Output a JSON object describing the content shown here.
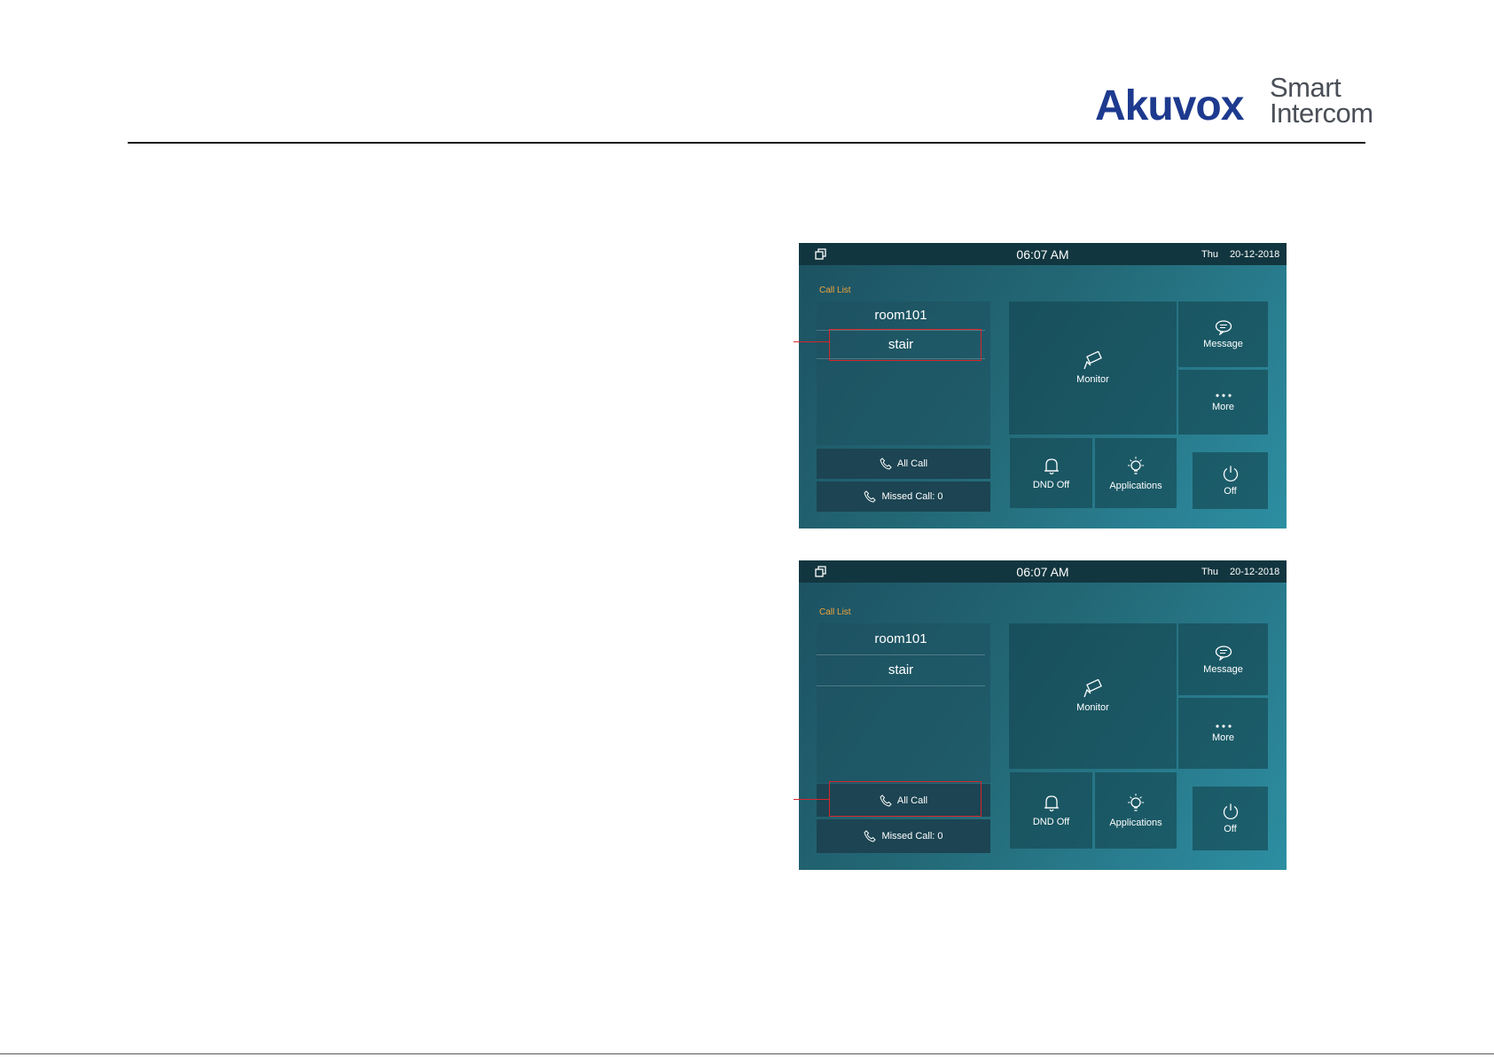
{
  "brand": {
    "logo_name": "Akuvox",
    "logo_tagline_line1": "Smart",
    "logo_tagline_line2": "Intercom",
    "accent_color": "#1d3a8f"
  },
  "screens": [
    {
      "status": {
        "time": "06:07 AM",
        "day": "Thu",
        "date": "20-12-2018"
      },
      "call_list_title": "Call List",
      "call_list": [
        "room101",
        "stair"
      ],
      "highlighted_item": "stair",
      "all_call_label": "All Call",
      "missed_call_label": "Missed Call: 0",
      "tiles": {
        "monitor": "Monitor",
        "message": "Message",
        "more": "More",
        "dnd": "DND Off",
        "applications": "Applications",
        "off": "Off"
      }
    },
    {
      "status": {
        "time": "06:07 AM",
        "day": "Thu",
        "date": "20-12-2018"
      },
      "call_list_title": "Call List",
      "call_list": [
        "room101",
        "stair"
      ],
      "highlighted_item": "All Call",
      "all_call_label": "All Call",
      "missed_call_label": "Missed Call: 0",
      "tiles": {
        "monitor": "Monitor",
        "message": "Message",
        "more": "More",
        "dnd": "DND Off",
        "applications": "Applications",
        "off": "Off"
      }
    }
  ],
  "colors": {
    "status_bar": "#12363f",
    "call_list_title": "#f0a53a",
    "highlight": "#d9262b",
    "screen_background": "#236876"
  },
  "icons": [
    "window-icon",
    "phone-icon",
    "camera-icon",
    "chat-icon",
    "more-dots-icon",
    "bell-icon",
    "bulb-icon",
    "power-icon"
  ]
}
